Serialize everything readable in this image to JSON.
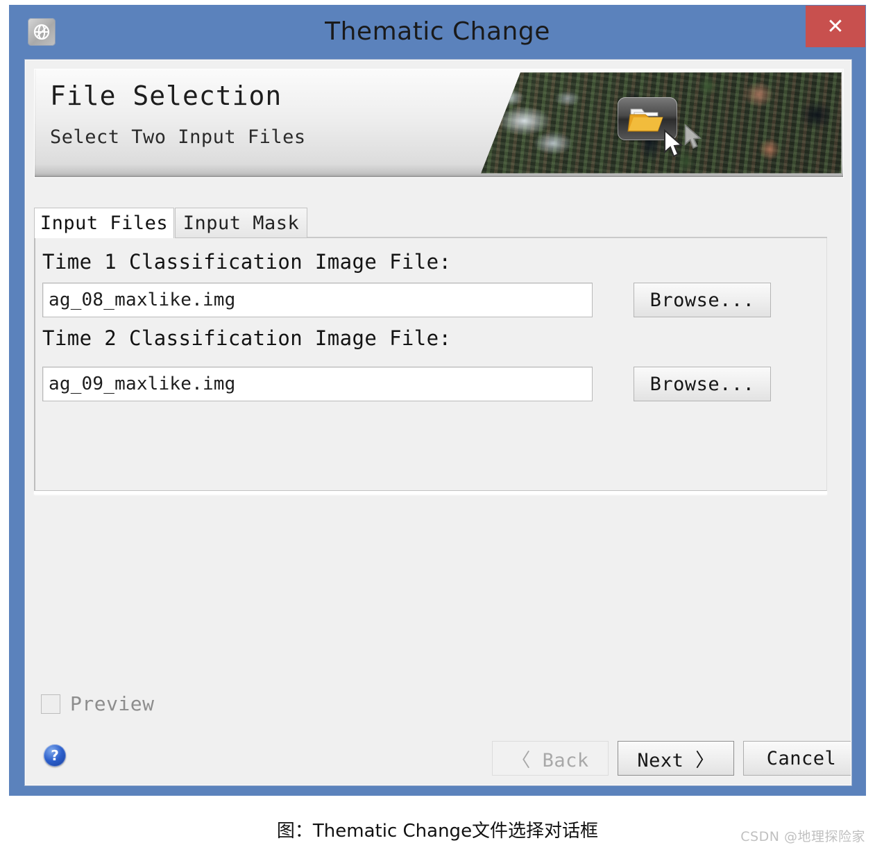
{
  "window": {
    "title": "Thematic Change",
    "app_icon": "globe-icon",
    "close_label": "✕"
  },
  "banner": {
    "title": "File Selection",
    "subtitle": "Select Two Input Files",
    "image": "satellite-landcover-image",
    "overlay_icon": "open-folder-icon",
    "cursor_icon": "mouse-pointer-icon"
  },
  "tabs": [
    {
      "label": "Input Files",
      "active": true
    },
    {
      "label": "Input Mask",
      "active": false
    }
  ],
  "fields": [
    {
      "label": "Time 1 Classification Image File:",
      "value": "ag_08_maxlike.img",
      "placeholder": "",
      "browse_label": "Browse..."
    },
    {
      "label": "Time 2 Classification Image File:",
      "value": "ag_09_maxlike.img",
      "placeholder": "",
      "browse_label": "Browse..."
    }
  ],
  "preview": {
    "label": "Preview",
    "checked": false
  },
  "footer": {
    "help_label": "?",
    "back_label": "〈 Back",
    "next_label": "Next 〉",
    "cancel_label": "Cancel"
  },
  "caption": {
    "text": "图：Thematic Change文件选择对话框",
    "watermark": "CSDN @地理探险家"
  },
  "colors": {
    "titlebar_blue": "#5b82bc",
    "close_red": "#c8504e",
    "client_gray": "#f0f0f0",
    "help_blue": "#2c5fcb"
  }
}
